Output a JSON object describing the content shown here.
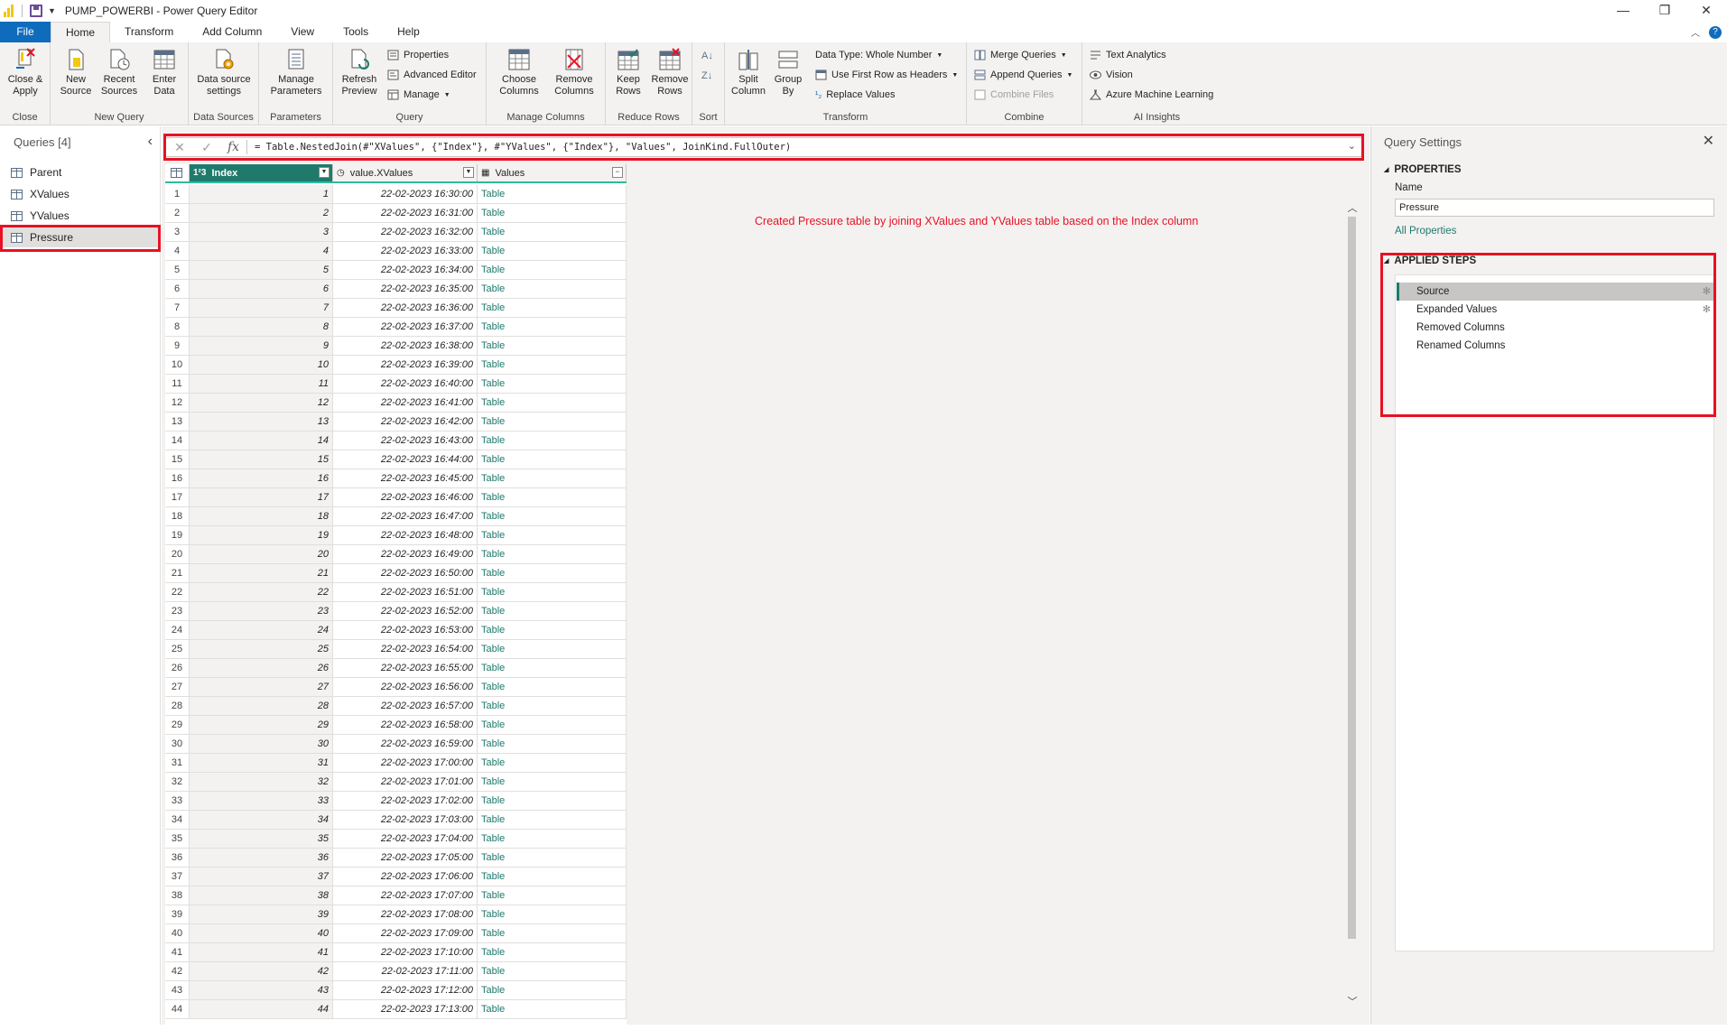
{
  "window": {
    "title": "PUMP_POWERBI - Power Query Editor"
  },
  "menu": {
    "file": "File",
    "tabs": [
      "Home",
      "Transform",
      "Add Column",
      "View",
      "Tools",
      "Help"
    ]
  },
  "ribbon": {
    "close_apply": "Close &\nApply",
    "new_source": "New\nSource",
    "recent_sources": "Recent\nSources",
    "enter_data": "Enter\nData",
    "data_source_settings": "Data source\nsettings",
    "manage_parameters": "Manage\nParameters",
    "refresh_preview": "Refresh\nPreview",
    "properties": "Properties",
    "advanced_editor": "Advanced Editor",
    "manage": "Manage",
    "choose_columns": "Choose\nColumns",
    "remove_columns": "Remove\nColumns",
    "keep_rows": "Keep\nRows",
    "remove_rows": "Remove\nRows",
    "split_column": "Split\nColumn",
    "group_by": "Group\nBy",
    "data_type": "Data Type: Whole Number",
    "first_row_headers": "Use First Row as Headers",
    "replace_values": "Replace Values",
    "merge_queries": "Merge Queries",
    "append_queries": "Append Queries",
    "combine_files": "Combine Files",
    "text_analytics": "Text Analytics",
    "vision": "Vision",
    "azure_ml": "Azure Machine Learning",
    "groups": {
      "close": "Close",
      "new_query": "New Query",
      "data_sources": "Data Sources",
      "parameters": "Parameters",
      "query": "Query",
      "manage_columns": "Manage Columns",
      "reduce_rows": "Reduce Rows",
      "sort": "Sort",
      "transform": "Transform",
      "combine": "Combine",
      "ai_insights": "AI Insights"
    }
  },
  "queries": {
    "header": "Queries [4]",
    "items": [
      "Parent",
      "XValues",
      "YValues",
      "Pressure"
    ],
    "selected": "Pressure"
  },
  "formula": "= Table.NestedJoin(#\"XValues\", {\"Index\"}, #\"YValues\", {\"Index\"}, \"Values\", JoinKind.FullOuter)",
  "grid": {
    "columns": [
      {
        "name": "Index",
        "type": "1²3"
      },
      {
        "name": "value.XValues",
        "type": "date"
      },
      {
        "name": "Values",
        "type": "table"
      }
    ],
    "rows": [
      [
        "1",
        "1",
        "22-02-2023 16:30:00",
        "Table"
      ],
      [
        "2",
        "2",
        "22-02-2023 16:31:00",
        "Table"
      ],
      [
        "3",
        "3",
        "22-02-2023 16:32:00",
        "Table"
      ],
      [
        "4",
        "4",
        "22-02-2023 16:33:00",
        "Table"
      ],
      [
        "5",
        "5",
        "22-02-2023 16:34:00",
        "Table"
      ],
      [
        "6",
        "6",
        "22-02-2023 16:35:00",
        "Table"
      ],
      [
        "7",
        "7",
        "22-02-2023 16:36:00",
        "Table"
      ],
      [
        "8",
        "8",
        "22-02-2023 16:37:00",
        "Table"
      ],
      [
        "9",
        "9",
        "22-02-2023 16:38:00",
        "Table"
      ],
      [
        "10",
        "10",
        "22-02-2023 16:39:00",
        "Table"
      ],
      [
        "11",
        "11",
        "22-02-2023 16:40:00",
        "Table"
      ],
      [
        "12",
        "12",
        "22-02-2023 16:41:00",
        "Table"
      ],
      [
        "13",
        "13",
        "22-02-2023 16:42:00",
        "Table"
      ],
      [
        "14",
        "14",
        "22-02-2023 16:43:00",
        "Table"
      ],
      [
        "15",
        "15",
        "22-02-2023 16:44:00",
        "Table"
      ],
      [
        "16",
        "16",
        "22-02-2023 16:45:00",
        "Table"
      ],
      [
        "17",
        "17",
        "22-02-2023 16:46:00",
        "Table"
      ],
      [
        "18",
        "18",
        "22-02-2023 16:47:00",
        "Table"
      ],
      [
        "19",
        "19",
        "22-02-2023 16:48:00",
        "Table"
      ],
      [
        "20",
        "20",
        "22-02-2023 16:49:00",
        "Table"
      ],
      [
        "21",
        "21",
        "22-02-2023 16:50:00",
        "Table"
      ],
      [
        "22",
        "22",
        "22-02-2023 16:51:00",
        "Table"
      ],
      [
        "23",
        "23",
        "22-02-2023 16:52:00",
        "Table"
      ],
      [
        "24",
        "24",
        "22-02-2023 16:53:00",
        "Table"
      ],
      [
        "25",
        "25",
        "22-02-2023 16:54:00",
        "Table"
      ],
      [
        "26",
        "26",
        "22-02-2023 16:55:00",
        "Table"
      ],
      [
        "27",
        "27",
        "22-02-2023 16:56:00",
        "Table"
      ],
      [
        "28",
        "28",
        "22-02-2023 16:57:00",
        "Table"
      ],
      [
        "29",
        "29",
        "22-02-2023 16:58:00",
        "Table"
      ],
      [
        "30",
        "30",
        "22-02-2023 16:59:00",
        "Table"
      ],
      [
        "31",
        "31",
        "22-02-2023 17:00:00",
        "Table"
      ],
      [
        "32",
        "32",
        "22-02-2023 17:01:00",
        "Table"
      ],
      [
        "33",
        "33",
        "22-02-2023 17:02:00",
        "Table"
      ],
      [
        "34",
        "34",
        "22-02-2023 17:03:00",
        "Table"
      ],
      [
        "35",
        "35",
        "22-02-2023 17:04:00",
        "Table"
      ],
      [
        "36",
        "36",
        "22-02-2023 17:05:00",
        "Table"
      ],
      [
        "37",
        "37",
        "22-02-2023 17:06:00",
        "Table"
      ],
      [
        "38",
        "38",
        "22-02-2023 17:07:00",
        "Table"
      ],
      [
        "39",
        "39",
        "22-02-2023 17:08:00",
        "Table"
      ],
      [
        "40",
        "40",
        "22-02-2023 17:09:00",
        "Table"
      ],
      [
        "41",
        "41",
        "22-02-2023 17:10:00",
        "Table"
      ],
      [
        "42",
        "42",
        "22-02-2023 17:11:00",
        "Table"
      ],
      [
        "43",
        "43",
        "22-02-2023 17:12:00",
        "Table"
      ],
      [
        "44",
        "44",
        "22-02-2023 17:13:00",
        "Table"
      ]
    ]
  },
  "annotation": "Created Pressure table by joining XValues and YValues table based on the Index column",
  "settings": {
    "title": "Query Settings",
    "properties_header": "PROPERTIES",
    "name_label": "Name",
    "name_value": "Pressure",
    "all_properties": "All Properties",
    "steps_header": "APPLIED STEPS",
    "steps": [
      "Source",
      "Expanded Values",
      "Removed Columns",
      "Renamed Columns"
    ]
  },
  "colors": {
    "accent": "#1f7a6c",
    "file_tab": "#0f6cbd",
    "highlight": "#e81123"
  }
}
